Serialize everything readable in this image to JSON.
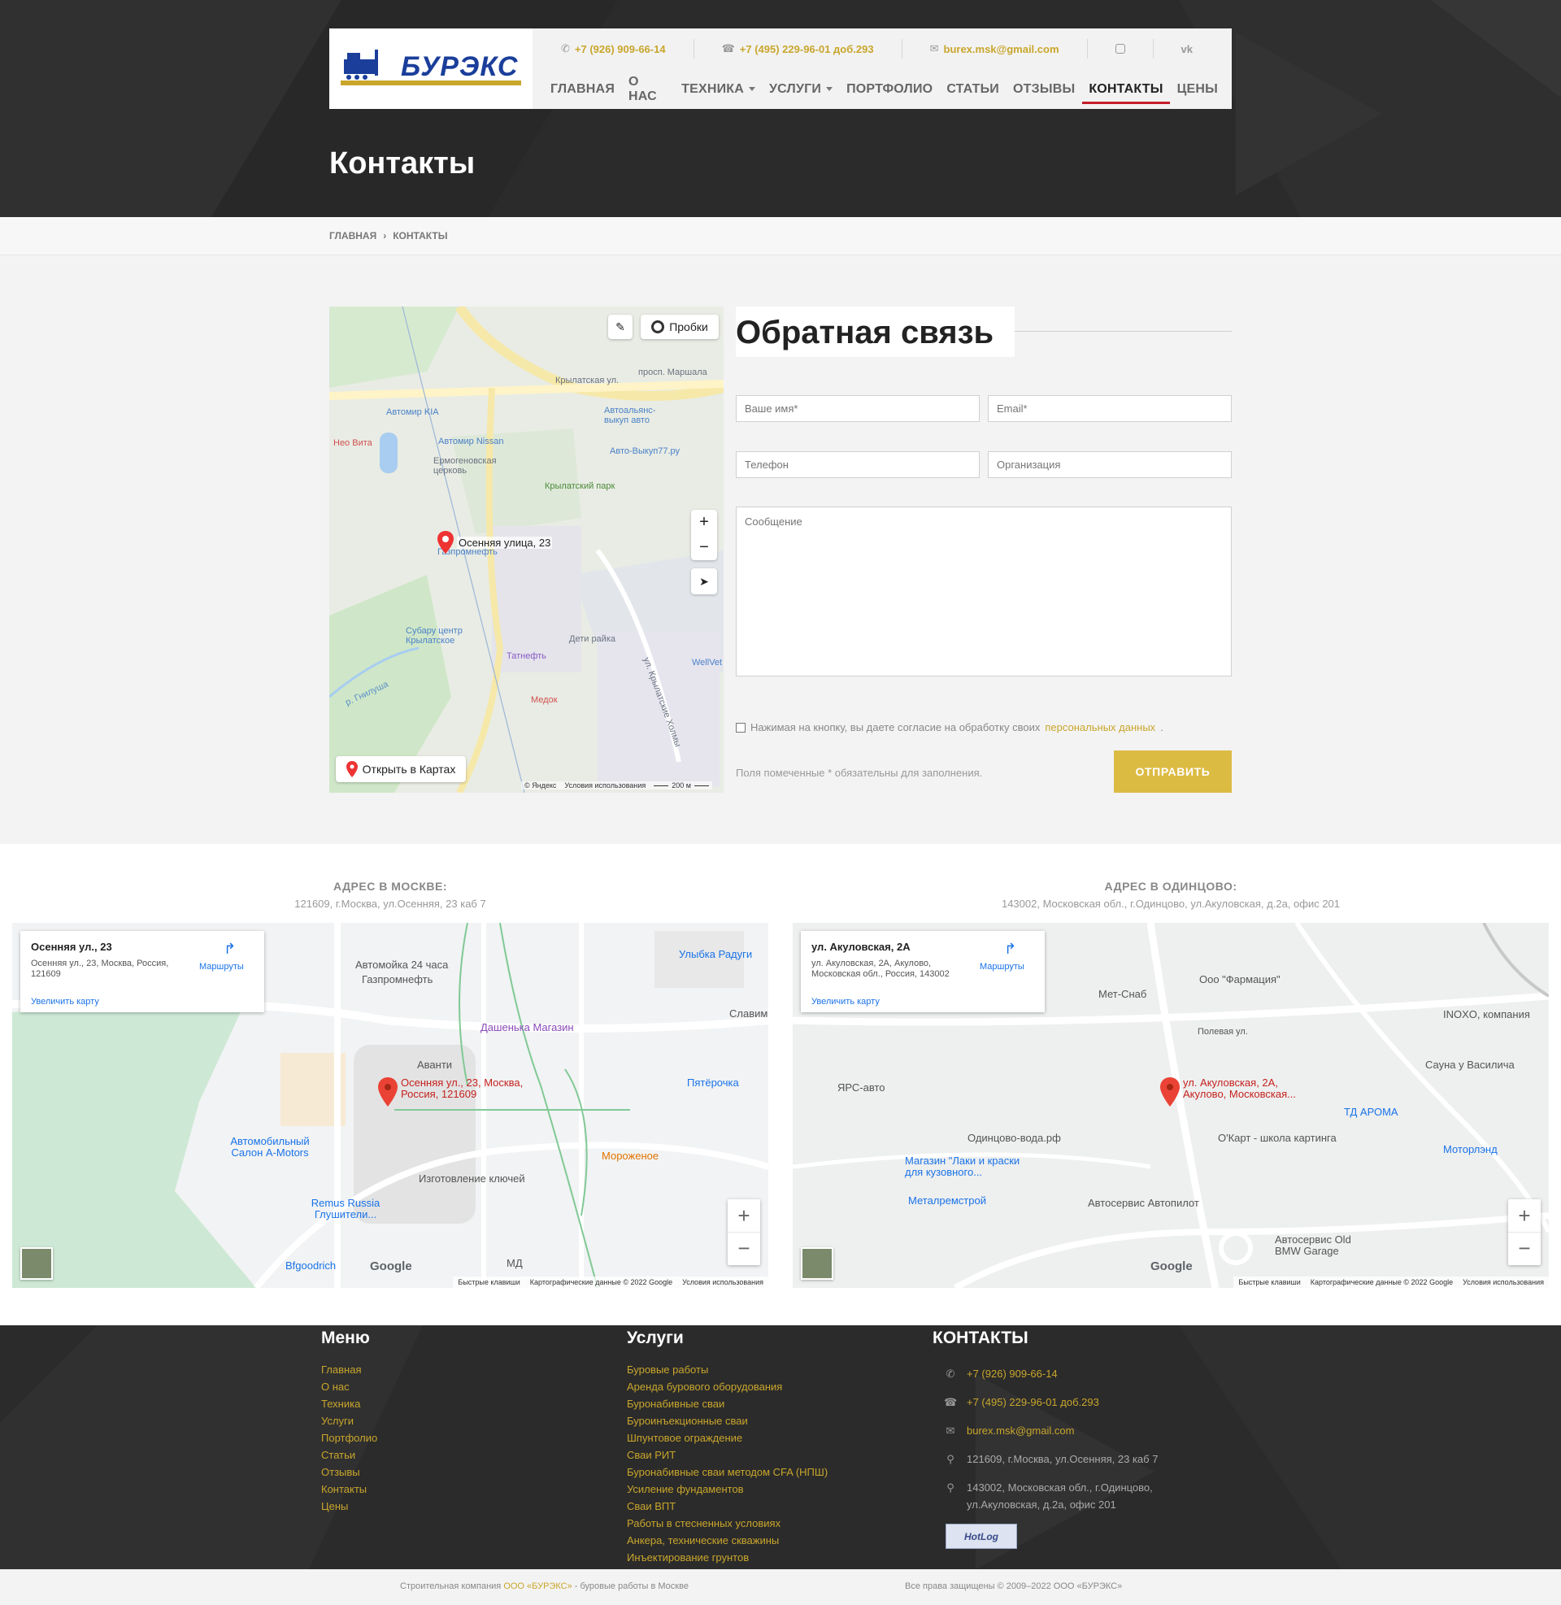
{
  "header": {
    "logo_text": "БУРЭКС",
    "phone1": "+7 (926) 909-66-14",
    "phone2": "+7 (495) 229-96-01 доб.293",
    "email": "burex.msk@gmail.com",
    "social": [
      {
        "icon": "instagram-icon"
      },
      {
        "icon": "vk-icon",
        "label": "vk"
      }
    ],
    "nav": [
      "ГЛАВНАЯ",
      "О НАС",
      "ТЕХНИКА",
      "УСЛУГИ",
      "ПОРТФОЛИО",
      "СТАТЬИ",
      "ОТЗЫВЫ",
      "КОНТАКТЫ",
      "ЦЕНЫ"
    ],
    "nav_active": "КОНТАКТЫ",
    "colors": {
      "accent": "#c9a62c",
      "active_underline": "#c41e2a"
    }
  },
  "page_title": "Контакты",
  "breadcrumb": [
    "ГЛАВНАЯ",
    "КОНТАКТЫ"
  ],
  "yandex_map": {
    "traffic_button": "Пробки",
    "marker_label": "Осенняя улица, 23",
    "open_in_maps": "Открыть в Картах",
    "copyright": "© Яндекс",
    "terms": "Условия использования",
    "scale": "200 м",
    "labels": [
      "Крылатская ул.",
      "просп. Маршала",
      "Ермогеновская церковь",
      "Крылатский парк",
      "Дети райка",
      "ул. Крылатские Холмы",
      "р. Гнилуша"
    ],
    "poi": [
      "Автомир KIA",
      "Автомир Nissan",
      "Автоальянс-выкуп авто",
      "Авто-Выкуп77.ру",
      "Нео Вита",
      "Газпромнефть",
      "Субару центр Крылатское",
      "Татнефть",
      "Медок",
      "WellVet"
    ]
  },
  "feedback": {
    "title": "Обратная связь",
    "name_placeholder": "Ваше имя*",
    "email_placeholder": "Email*",
    "phone_placeholder": "Телефон",
    "org_placeholder": "Организация",
    "message_placeholder": "Сообщение",
    "consent_text": "Нажимая на кнопку, вы даете согласие на обработку своих",
    "consent_link": "персональных данных",
    "required_note": "Поля помеченные * обязательны для заполнения.",
    "submit": "ОТПРАВИТЬ"
  },
  "addresses": [
    {
      "title": "АДРЕС В МОСКВЕ:",
      "line": "121609, г.Москва, ул.Осенняя, 23 каб 7",
      "map": {
        "place": "Осенняя ул., 23",
        "address": "Осенняя ул., 23, Москва, Россия, 121609",
        "routes": "Маршруты",
        "enlarge": "Увеличить карту",
        "marker": "Осенняя ул., 23, Москва, Россия, 121609",
        "footer": [
          "Быстрые клавиши",
          "Картографические данные © 2022 Google",
          "Условия использования"
        ],
        "labels": [
          "Автомойка 24 часа",
          "Газпромнефть",
          "Улыбка Радуги",
          "Дашенька Магазин",
          "Аванти",
          "Пятёрочка",
          "Мороженое",
          "Изготовление ключей",
          "Автомобильный Салон A-Motors",
          "Remus Russia Глушители...",
          "Bfgoodrich",
          "МД",
          "Славим"
        ]
      }
    },
    {
      "title": "АДРЕС В ОДИНЦОВО:",
      "line": "143002, Московская обл., г.Одинцово, ул.Акуловская, д.2а, офис 201",
      "map": {
        "place": "ул. Акуловская, 2А",
        "address": "ул. Акуловская, 2А, Акулово, Московская обл., Россия, 143002",
        "routes": "Маршруты",
        "enlarge": "Увеличить карту",
        "marker": "ул. Акуловская, 2А, Акулово, Московская...",
        "footer": [
          "Быстрые клавиши",
          "Картографические данные © 2022 Google",
          "Условия использования"
        ],
        "labels": [
          "Ооо \"Фармация\"",
          "Мет-Снаб",
          "Полевая ул.",
          "INOXO, компания",
          "Сауна у Василича",
          "ЯРС-авто",
          "ТД АРОМА",
          "О'Карт - школа картинга",
          "Одинцово-вода.рф",
          "Моторлэнд",
          "Магазин \"Лаки и краски для кузовного...",
          "Металремстрой",
          "Автосервис Автопилот",
          "Автосервис Old BMW Garage"
        ]
      }
    }
  ],
  "footer": {
    "menu_title": "Меню",
    "menu": [
      "Главная",
      "О нас",
      "Техника",
      "Услуги",
      "Портфолио",
      "Статьи",
      "Отзывы",
      "Контакты",
      "Цены"
    ],
    "services_title": "Услуги",
    "services": [
      "Буровые работы",
      "Аренда бурового оборудования",
      "Буронабивные сваи",
      "Буроинъекционные сваи",
      "Шпунтовое ограждение",
      "Сваи РИТ",
      "Буронабивные сваи методом CFA (НПШ)",
      "Усиление фундаментов",
      "Сваи ВПТ",
      "Работы в стесненных условиях",
      "Анкера, технические скважины",
      "Инъектирование грунтов"
    ],
    "contacts_title": "КОНТАКТЫ",
    "phone1": "+7 (926) 909-66-14",
    "phone2": "+7 (495) 229-96-01 доб.293",
    "email": "burex.msk@gmail.com",
    "address1": "121609, г.Москва, ул.Осенняя, 23 каб 7",
    "address2": "143002, Московская обл., г.Одинцово, ул.Акуловская, д.2а, офис 201",
    "counter": "HotLog"
  },
  "bottombar": {
    "left_prefix": "Строительная компания",
    "left_link": "ООО «БУРЭКС»",
    "left_suffix": "- буровые работы в Москве",
    "right": "Все права защищены © 2009–2022 ООО «БУРЭКС»"
  }
}
